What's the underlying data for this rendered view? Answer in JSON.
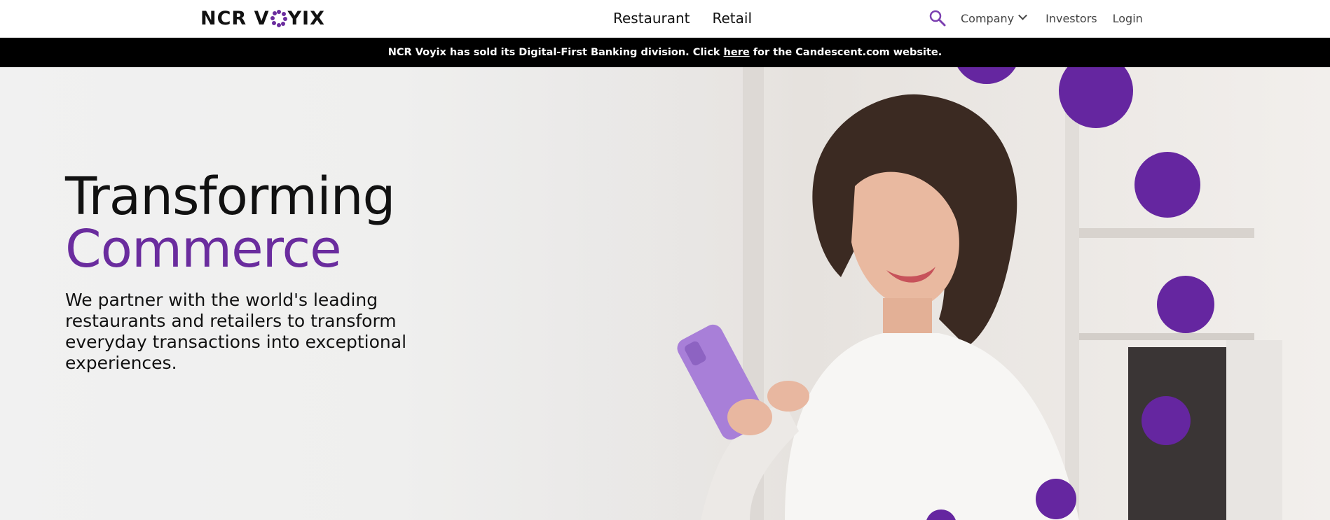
{
  "header": {
    "logo_text_left": "NCR V",
    "logo_text_right": "YIX",
    "nav": [
      "Restaurant",
      "Retail"
    ],
    "company_label": "Company",
    "investors_label": "Investors",
    "login_label": "Login"
  },
  "banner": {
    "text_before": "NCR Voyix has sold its Digital-First Banking division. Click",
    "link_text": "here",
    "text_after": "for the Candescent.com website."
  },
  "hero": {
    "title_line1": "Transforming",
    "title_line2": "Commerce",
    "subtitle": "We partner with the world's leading restaurants and retailers to transform everyday transactions into exceptional experiences."
  },
  "colors": {
    "brand_purple": "#6a2c9e",
    "banner_bg": "#000000",
    "header_bg": "#ffffff"
  },
  "icons": [
    "search-icon",
    "chevron-down-icon"
  ]
}
